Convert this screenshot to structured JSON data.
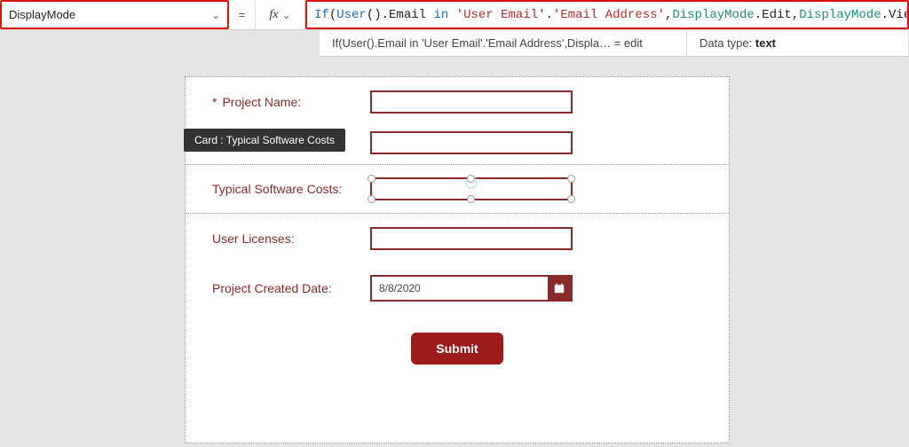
{
  "topbar": {
    "property_name": "DisplayMode",
    "equals": "=",
    "fx_label": "fx",
    "formula_tokens": [
      {
        "t": "fun",
        "v": "If"
      },
      {
        "t": "plain",
        "v": "("
      },
      {
        "t": "fun",
        "v": "User"
      },
      {
        "t": "plain",
        "v": "().Email "
      },
      {
        "t": "fun",
        "v": "in"
      },
      {
        "t": "plain",
        "v": " "
      },
      {
        "t": "lit",
        "v": "'User Email'"
      },
      {
        "t": "plain",
        "v": "."
      },
      {
        "t": "lit",
        "v": "'Email Address'"
      },
      {
        "t": "plain",
        "v": ","
      },
      {
        "t": "enum",
        "v": "DisplayMode"
      },
      {
        "t": "plain",
        "v": ".Edit,"
      },
      {
        "t": "enum",
        "v": "DisplayMode"
      },
      {
        "t": "plain",
        "v": ".View)"
      }
    ]
  },
  "infobar": {
    "summary": "If(User().Email in 'User Email'.'Email Address',Displa…   =  edit",
    "datatype_label": "Data type:",
    "datatype_value": "text"
  },
  "tooltip": {
    "text": "Card : Typical Software Costs"
  },
  "form": {
    "project_name_label": "Project Name:",
    "typical_costs_label": "Typical Software Costs:",
    "user_licenses_label": "User Licenses:",
    "created_date_label": "Project Created Date:",
    "created_date_value": "8/8/2020",
    "submit_label": "Submit"
  }
}
